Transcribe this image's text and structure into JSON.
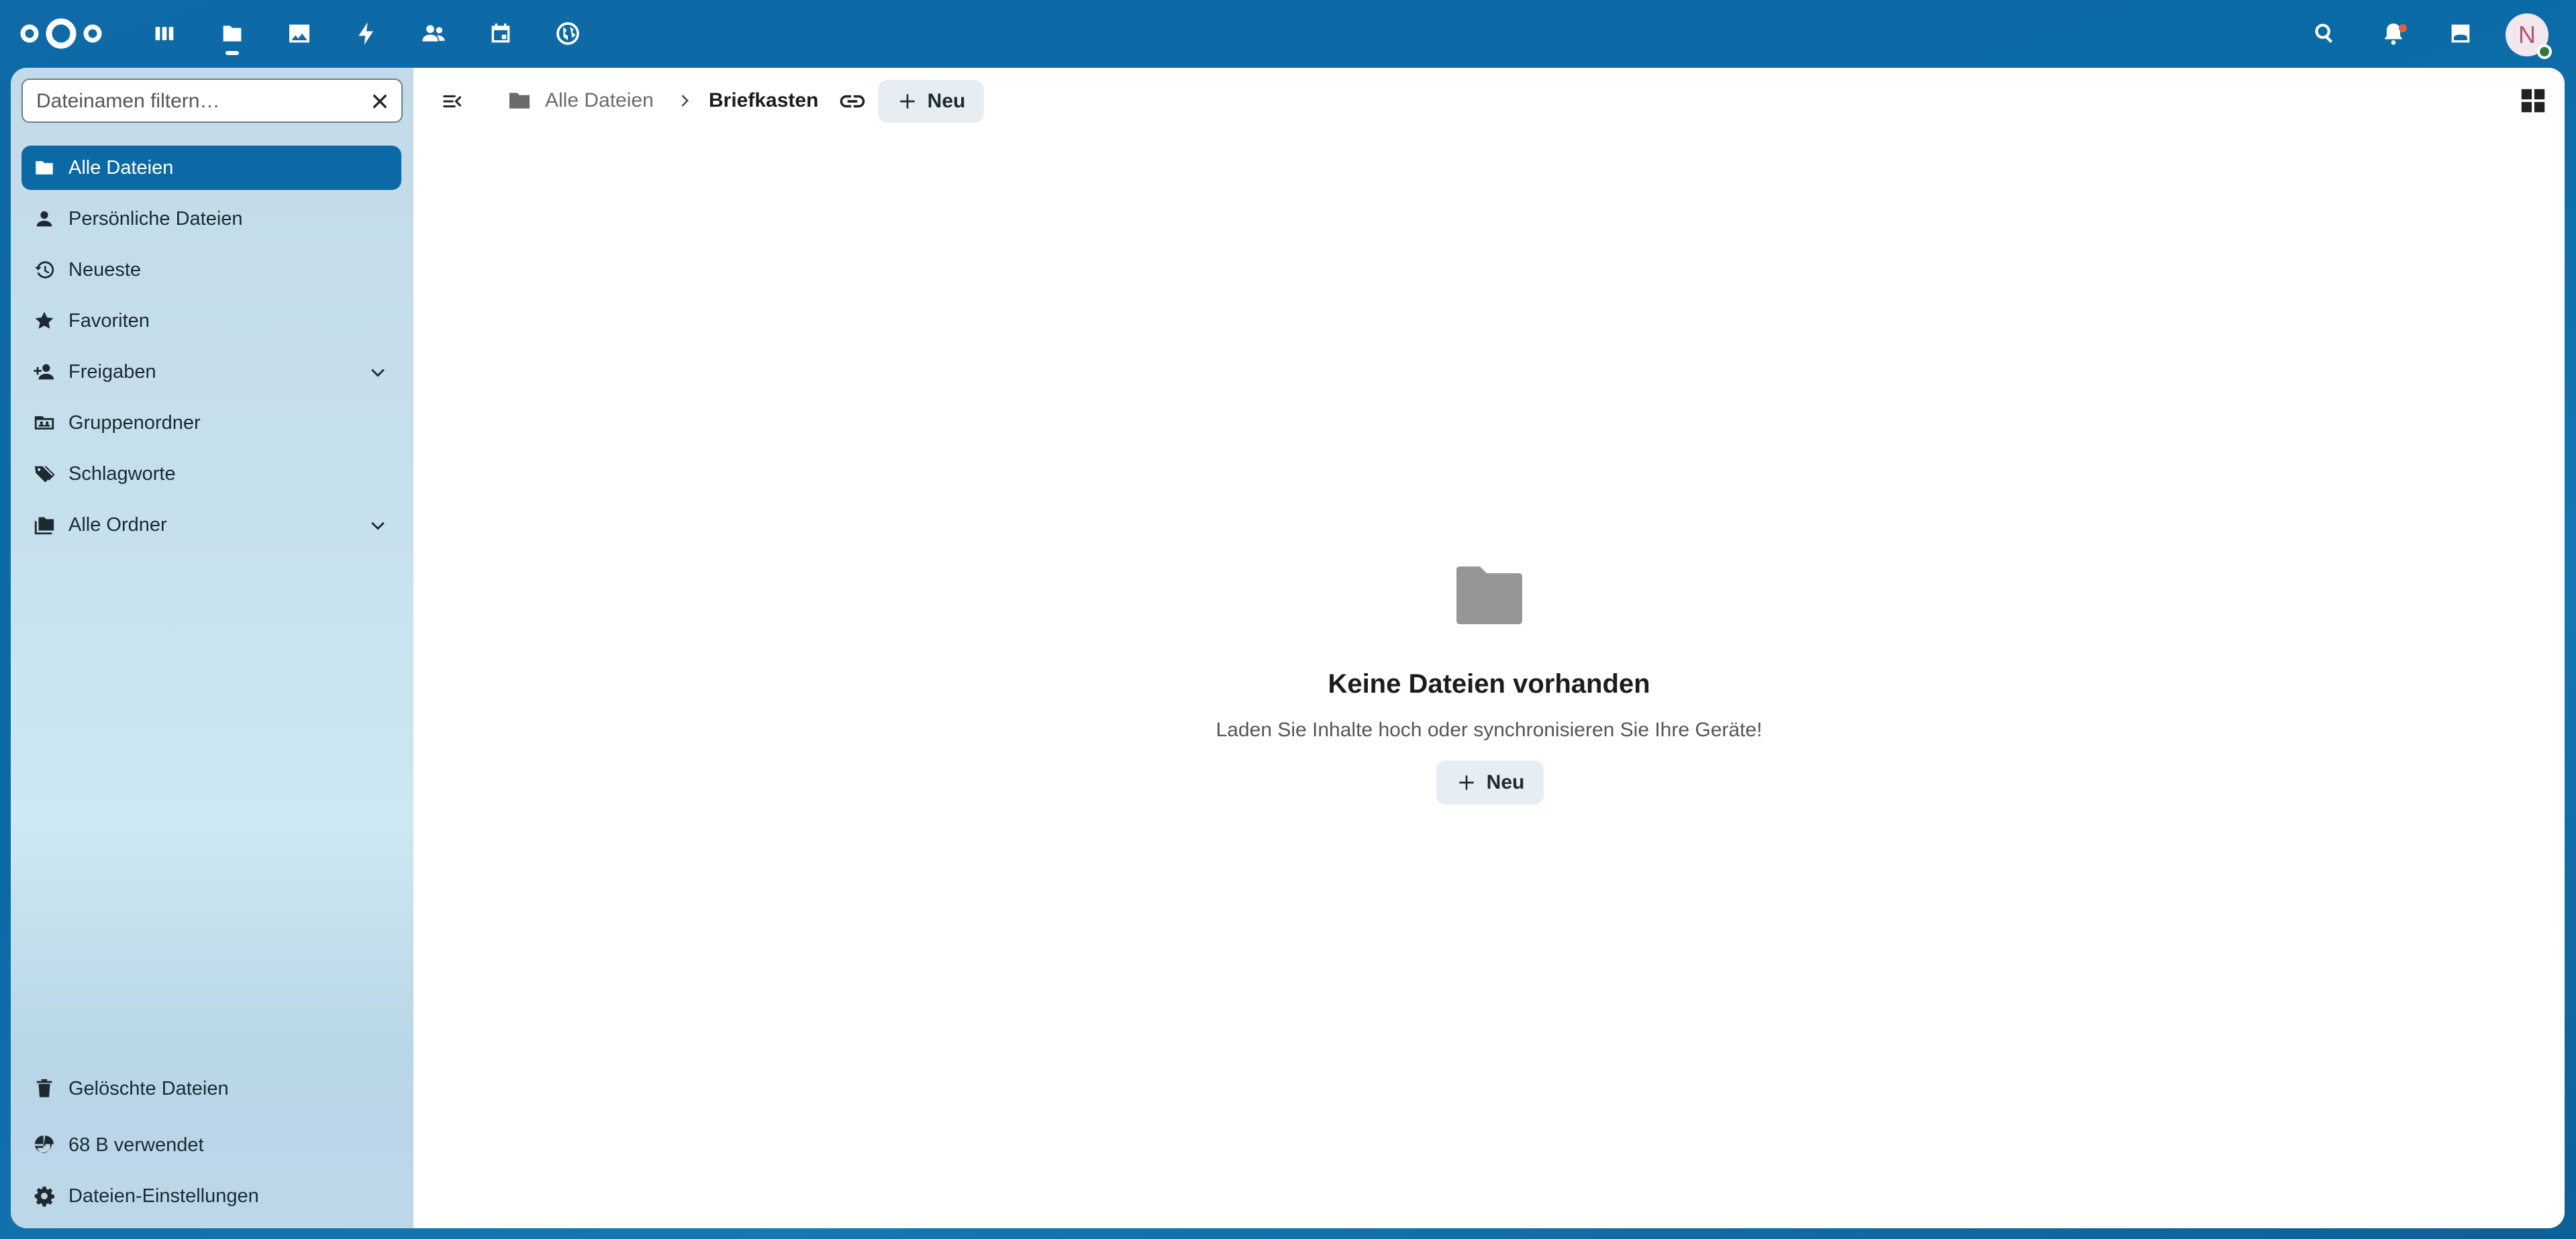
{
  "header": {
    "apps": [
      {
        "name": "dashboard-icon"
      },
      {
        "name": "files-icon"
      },
      {
        "name": "photos-icon"
      },
      {
        "name": "activity-icon"
      },
      {
        "name": "contacts-icon"
      },
      {
        "name": "calendar-icon"
      },
      {
        "name": "web-icon"
      }
    ],
    "avatar_initial": "N"
  },
  "sidebar": {
    "filter_placeholder": "Dateinamen filtern…",
    "items": [
      {
        "label": "Alle Dateien",
        "icon": "folder-icon",
        "active": true
      },
      {
        "label": "Persönliche Dateien",
        "icon": "person-icon"
      },
      {
        "label": "Neueste",
        "icon": "history-icon"
      },
      {
        "label": "Favoriten",
        "icon": "star-icon"
      },
      {
        "label": "Freigaben",
        "icon": "share-icon",
        "expandable": true
      },
      {
        "label": "Gruppenordner",
        "icon": "group-folder-icon"
      },
      {
        "label": "Schlagworte",
        "icon": "tag-icon"
      },
      {
        "label": "Alle Ordner",
        "icon": "folders-icon",
        "expandable": true
      }
    ],
    "footer": {
      "trash": "Gelöschte Dateien",
      "quota": "68 B verwendet",
      "settings": "Dateien-Einstellungen"
    }
  },
  "content": {
    "breadcrumb": [
      "Alle Dateien",
      "Briefkasten"
    ],
    "new_label": "Neu",
    "empty": {
      "title": "Keine Dateien vorhanden",
      "description": "Laden Sie Inhalte hoch oder synchronisieren Sie Ihre Geräte!",
      "button": "Neu"
    }
  },
  "colors": {
    "header": "#0b6aa7",
    "accent": "#0b69a5",
    "button_bg": "#e6eef4"
  }
}
